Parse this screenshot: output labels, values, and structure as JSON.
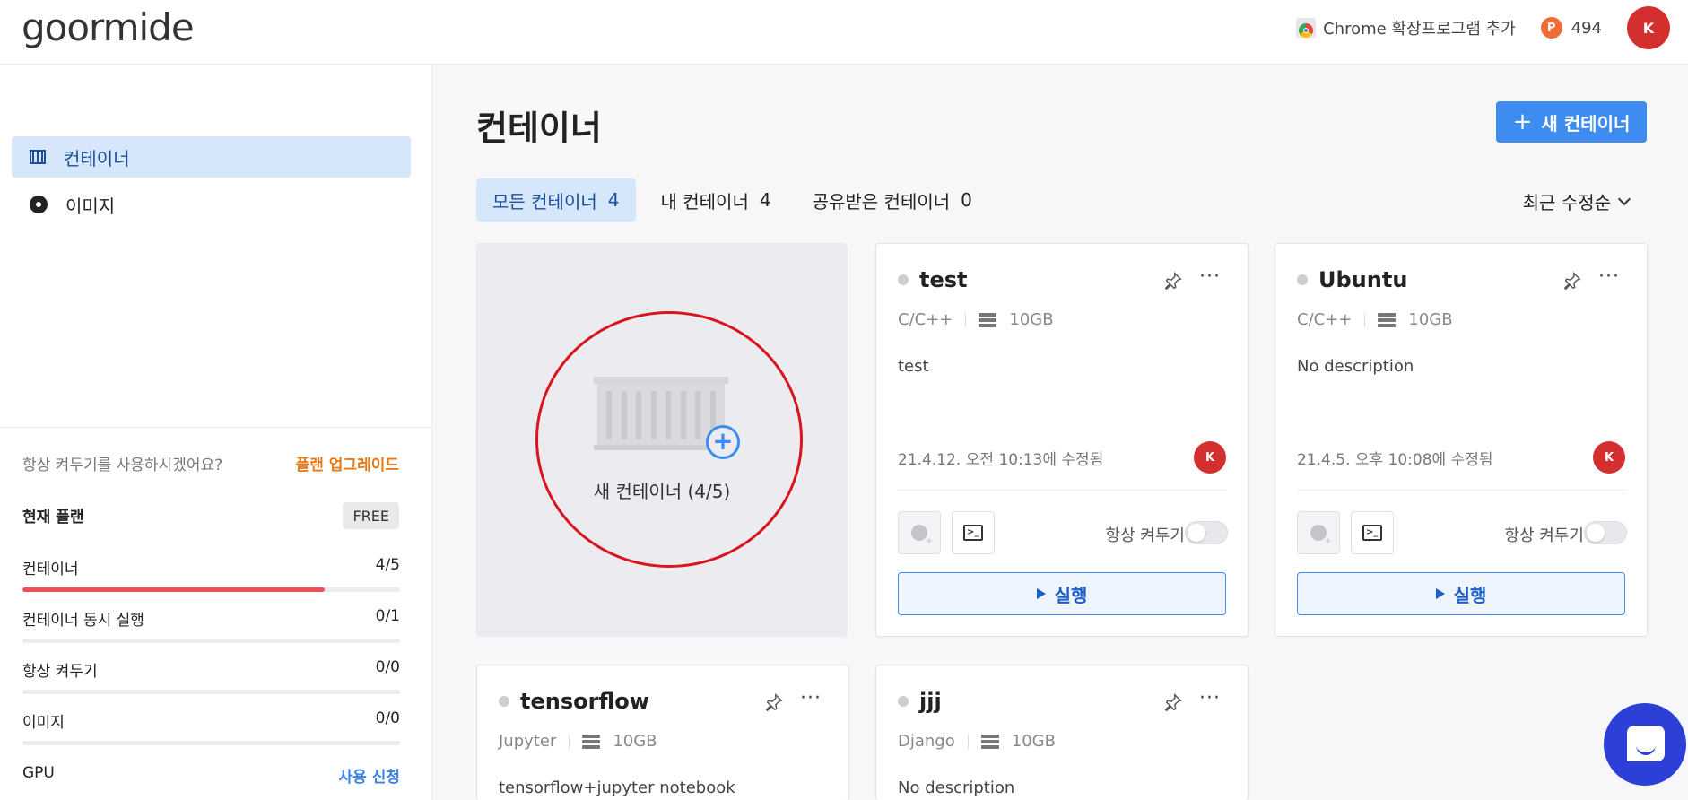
{
  "header": {
    "logo": "goormide",
    "chrome_ext": "Chrome 확장프로그램 추가",
    "points_badge": "P",
    "points": "494",
    "avatar": "K"
  },
  "sidebar": {
    "items": [
      {
        "label": "컨테이너",
        "icon": "container-icon",
        "active": true
      },
      {
        "label": "이미지",
        "icon": "disc-icon",
        "active": false
      }
    ],
    "plan_question": "항상 켜두기를 사용하시겠어요?",
    "plan_upgrade": "플랜 업그레이드",
    "current_plan_label": "현재 플랜",
    "current_plan": "FREE",
    "usage": [
      {
        "label": "컨테이너",
        "value": "4/5",
        "fraction": 0.8
      },
      {
        "label": "컨테이너 동시 실행",
        "value": "0/1",
        "fraction": 0
      },
      {
        "label": "항상 켜두기",
        "value": "0/0",
        "fraction": 0
      },
      {
        "label": "이미지",
        "value": "0/0",
        "fraction": 0
      }
    ],
    "gpu_label": "GPU",
    "gpu_apply": "사용 신청"
  },
  "main": {
    "title": "컨테이너",
    "new_button": "새 컨테이너",
    "new_button_icon": "+",
    "tabs": [
      {
        "label": "모든 컨테이너",
        "count": "4",
        "active": true
      },
      {
        "label": "내 컨테이너",
        "count": "4",
        "active": false
      },
      {
        "label": "공유받은 컨테이너",
        "count": "0",
        "active": false
      }
    ],
    "sort": "최근 수정순",
    "new_card_label": "새 컨테이너 (4/5)",
    "new_card_plus": "+",
    "more_icon": "···",
    "terminal_glyph": ">_",
    "always_on_label": "항상 켜두기",
    "run_label": "실행",
    "containers": [
      {
        "name": "test",
        "stack": "C/C++",
        "storage": "10GB",
        "description": "test",
        "modified": "21.4.12. 오전 10:13에 수정됨",
        "owner": "K"
      },
      {
        "name": "Ubuntu",
        "stack": "C/C++",
        "storage": "10GB",
        "description": "No description",
        "modified": "21.4.5. 오후 10:08에 수정됨",
        "owner": "K"
      },
      {
        "name": "tensorflow",
        "stack": "Jupyter",
        "storage": "10GB",
        "description": "tensorflow+jupyter notebook"
      },
      {
        "name": "jjj",
        "stack": "Django",
        "storage": "10GB",
        "description": "No description"
      }
    ]
  },
  "colors": {
    "accent": "#3f8cf0",
    "active_bg": "#d6e6fb",
    "upgrade": "#e57a17",
    "avatar": "#d42f2f",
    "usage_fill": "#ef4e5b",
    "annotation_circle": "#d8141e",
    "chat": "#2c3fd6"
  }
}
